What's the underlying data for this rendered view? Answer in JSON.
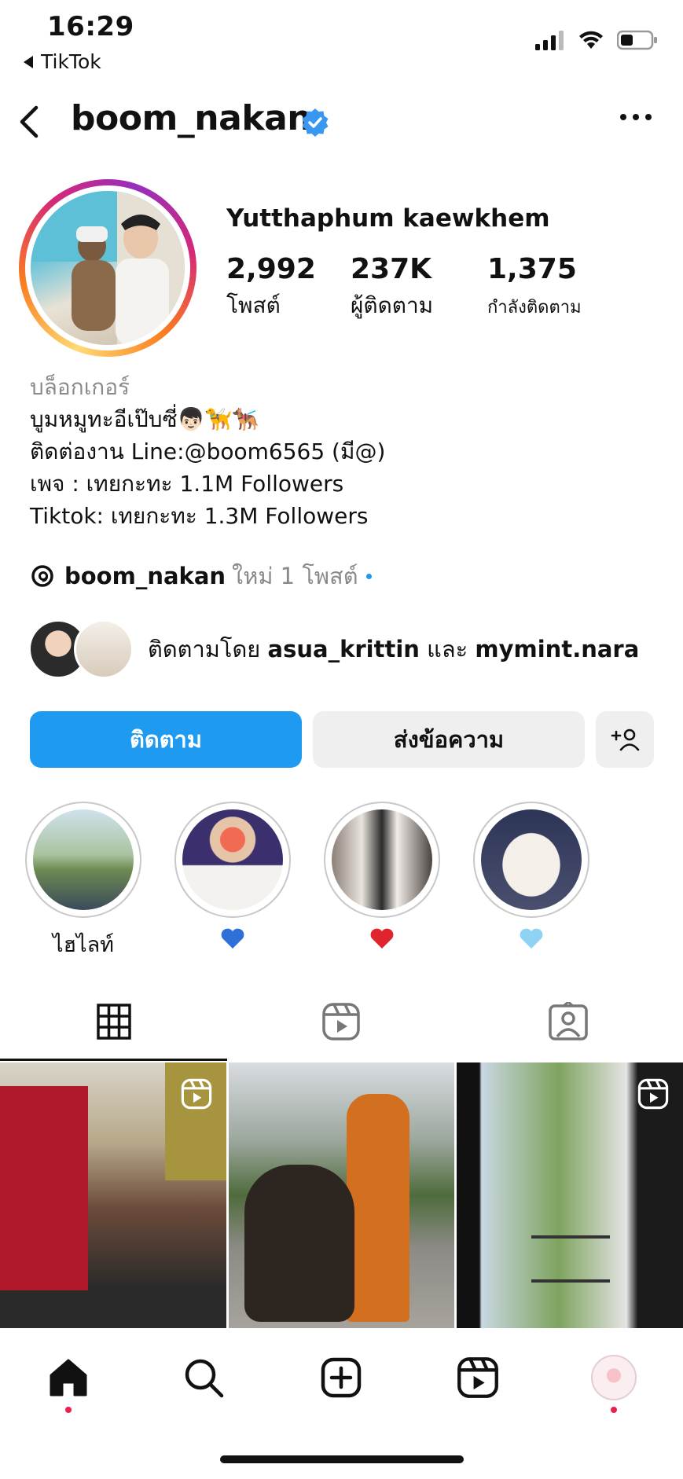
{
  "status_bar": {
    "time": "16:29",
    "back_app": "TikTok"
  },
  "header": {
    "username": "boom_nakan",
    "verified_icon": "verified-badge-icon"
  },
  "profile": {
    "display_name": "Yutthaphum kaewkhem",
    "stats": [
      {
        "value": "2,992",
        "label": "โพสต์"
      },
      {
        "value": "237K",
        "label": "ผู้ติดตาม"
      },
      {
        "value": "1,375",
        "label": "กำลังติดตาม"
      }
    ]
  },
  "bio": {
    "category": "บล็อกเกอร์",
    "line1": "บูมหมูทะอีเป๊บซี่",
    "line1_emojis": "👦🏻🦮🐕‍🦺",
    "line2": "ติดต่องาน Line:@boom6565 (มี@)",
    "line3": "เพจ : เทยกะทะ 1.1M Followers",
    "line4": "Tiktok: เทยกะทะ 1.3M Followers"
  },
  "threads": {
    "handle": "boom_nakan",
    "new_posts": "ใหม่ 1 โพสต์"
  },
  "followed_by": {
    "prefix": "ติดตามโดย",
    "user1": "asua_krittin",
    "conjunction": "และ",
    "user2": "mymint.nara"
  },
  "buttons": {
    "follow": "ติดตาม",
    "message": "ส่งข้อความ"
  },
  "highlights": [
    {
      "label": "ไฮไลท์",
      "kind": "text"
    },
    {
      "label": "💙",
      "kind": "heart",
      "color": "#2f6fd8"
    },
    {
      "label": "❤️",
      "kind": "heart",
      "color": "#e0242e"
    },
    {
      "label": "🩵",
      "kind": "heart",
      "color": "#8fd3f4"
    }
  ],
  "tabs": [
    "grid-icon",
    "reels-icon",
    "tagged-icon"
  ],
  "bottom_nav": [
    "home-icon",
    "search-icon",
    "create-icon",
    "reels-icon",
    "profile-avatar"
  ],
  "colors": {
    "accent": "#1e9bf0",
    "notification_dot": "#ed1f4b"
  }
}
